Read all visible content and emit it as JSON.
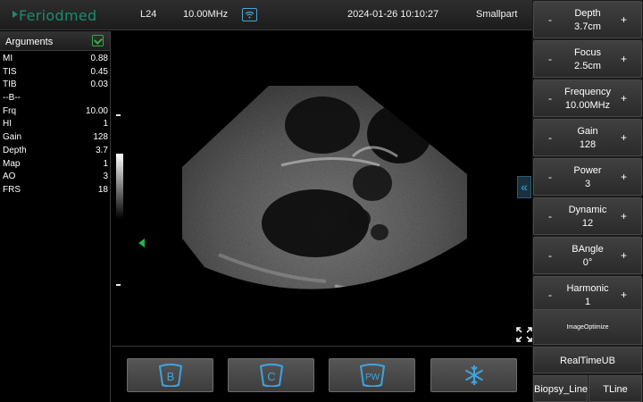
{
  "topbar": {
    "logo": "Feriodmed",
    "probe": "L24",
    "frequency": "10.00MHz",
    "datetime": "2024-01-26 10:10:27",
    "preset": "Smallpart"
  },
  "arguments": {
    "title": "Arguments",
    "rows": [
      {
        "label": "MI",
        "value": "0.88"
      },
      {
        "label": "TIS",
        "value": "0.45"
      },
      {
        "label": "TIB",
        "value": "0.03"
      },
      {
        "label": "--B--",
        "value": ""
      },
      {
        "label": "Frq",
        "value": "10.00"
      },
      {
        "label": "HI",
        "value": "1"
      },
      {
        "label": "Gain",
        "value": "128"
      },
      {
        "label": "Depth",
        "value": "3.7"
      },
      {
        "label": "Map",
        "value": "1"
      },
      {
        "label": "AO",
        "value": "3"
      },
      {
        "label": "FRS",
        "value": "18"
      }
    ]
  },
  "image": {
    "collapse_glyph": "«"
  },
  "modes": [
    {
      "label": "B",
      "icon": "b-mode-icon"
    },
    {
      "label": "C",
      "icon": "color-mode-icon"
    },
    {
      "label": "PW",
      "icon": "pw-mode-icon"
    },
    {
      "label": "",
      "icon": "freeze-icon"
    }
  ],
  "controls": [
    {
      "label": "Depth",
      "value": "3.7cm"
    },
    {
      "label": "Focus",
      "value": "2.5cm"
    },
    {
      "label": "Frequency",
      "value": "10.00MHz"
    },
    {
      "label": "Gain",
      "value": "128"
    },
    {
      "label": "Power",
      "value": "3"
    },
    {
      "label": "Dynamic",
      "value": "12"
    },
    {
      "label": "BAngle",
      "value": "0°"
    },
    {
      "label": "Harmonic",
      "value": "1"
    }
  ],
  "control_signs": {
    "minus": "-",
    "plus": "+"
  },
  "buttons": {
    "image_optimize": "ImageOptimize",
    "realtime": "RealTimeUB",
    "biopsy": "Biopsy_Line",
    "tline": "TLine"
  },
  "colors": {
    "accent": "#3fa3e0",
    "focus_marker": "#27b24a",
    "logo": "#1d8a6d"
  }
}
